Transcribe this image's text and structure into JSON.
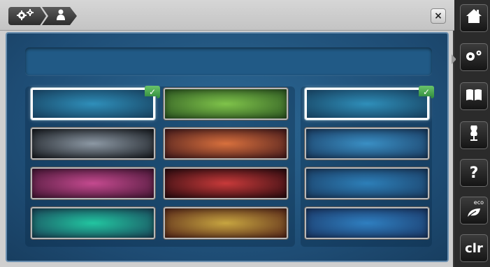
{
  "breadcrumb": [
    {
      "icon": "gears-icon"
    },
    {
      "icon": "user-icon"
    }
  ],
  "close_label": "×",
  "name_field": {
    "value": ""
  },
  "swatches_left": [
    {
      "color": "#2f8fba",
      "edge": "#17415f",
      "selected": true
    },
    {
      "color": "#7fc34a",
      "edge": "#2f5a23",
      "selected": false
    },
    {
      "color": "#8c98a4",
      "edge": "#1b1f24",
      "selected": false
    },
    {
      "color": "#d8703d",
      "edge": "#4a1d1d",
      "selected": false
    },
    {
      "color": "#c44a8f",
      "edge": "#4a1838",
      "selected": false
    },
    {
      "color": "#c83a3a",
      "edge": "#2e0c10",
      "selected": false
    },
    {
      "color": "#22c5a0",
      "edge": "#1a4a5c",
      "selected": false
    },
    {
      "color": "#c7a540",
      "edge": "#5a2a1a",
      "selected": false
    }
  ],
  "swatches_right": [
    {
      "color": "#2f8fba",
      "edge": "#17415f",
      "selected": true
    },
    {
      "color": "#3a8fc4",
      "edge": "#1b3f66",
      "selected": false
    },
    {
      "color": "#2d7fb8",
      "edge": "#1b3f66",
      "selected": false
    },
    {
      "color": "#2f7fc0",
      "edge": "#1b3a6a",
      "selected": false
    }
  ],
  "check_mark": "✓",
  "toolbar": {
    "home": {
      "icon": "home-icon"
    },
    "settings": {
      "icon": "gears-icon"
    },
    "tutorial": {
      "icon": "book-icon"
    },
    "guide": {
      "icon": "dress-form-icon"
    },
    "help": {
      "icon": "help-icon",
      "label": "?"
    },
    "eco": {
      "icon": "leaf-icon",
      "label": "eco"
    },
    "clr": {
      "label": "clr"
    }
  }
}
